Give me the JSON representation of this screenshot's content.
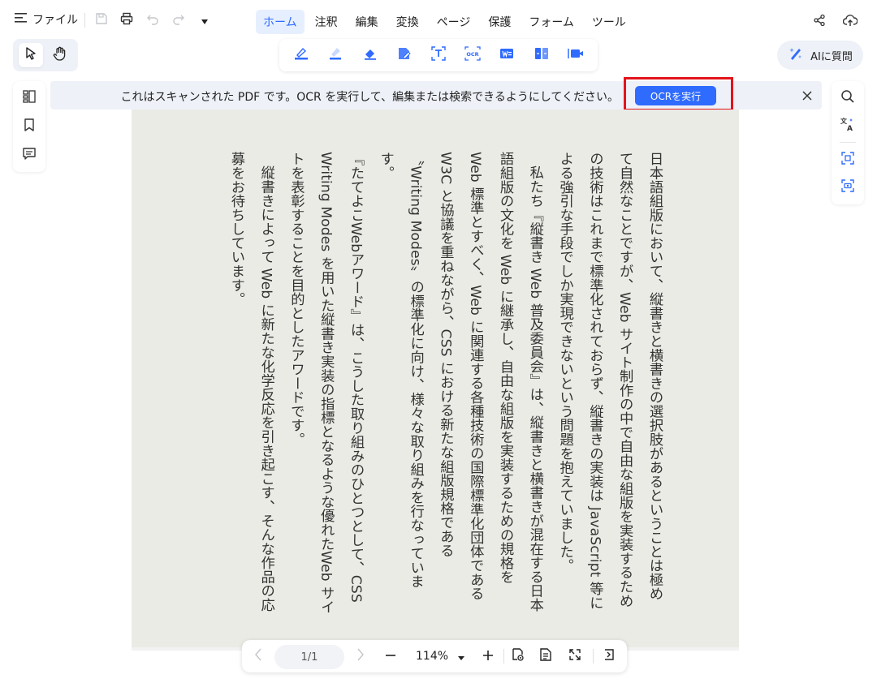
{
  "menu": {
    "file_label": "ファイル",
    "tabs": [
      {
        "label": "ホーム",
        "active": true
      },
      {
        "label": "注釈",
        "active": false
      },
      {
        "label": "編集",
        "active": false
      },
      {
        "label": "変換",
        "active": false
      },
      {
        "label": "ページ",
        "active": false
      },
      {
        "label": "保護",
        "active": false
      },
      {
        "label": "フォーム",
        "active": false
      },
      {
        "label": "ツール",
        "active": false
      }
    ]
  },
  "toolbar": {
    "ai_button_label": "AIに質問"
  },
  "banner": {
    "message": "これはスキャンされた PDF です。OCR を実行して、編集または検索できるようにしてください。",
    "ocr_button_label": "OCRを実行"
  },
  "document": {
    "paragraphs": [
      "日本語組版において、縦書きと横書きの選択肢があるということは極めて自然なことですが、Web サイト制作の中で自由な組版を実装するための技術はこれまで標準化されておらず、縦書きの実装は JavaScript 等による強引な手段でしか実現できないという問題を抱えていました。",
      "私たち『縦書き Web 普及委員会』は、縦書きと横書きが混在する日本語組版の文化を Web に継承し、自由な組版を実装するための規格を Web 標準とすべく、Web に関連する各種技術の国際標準化団体である W3C と協議を重ねながら、CSS における新たな組版規格である〝Writing Modes〟の標準化に向け、様々な取り組みを行なっています。",
      "",
      "『たてよこWebアワード』は、こうした取り組みのひとつとして、CSS Writing Modes を用いた縦書き実装の指標となるような優れたWeb サイトを表彰することを目的としたアワードです。",
      "縦書きによって Web に新たな化学反応を引き起こす、そんな作品の応募をお待ちしています。"
    ]
  },
  "navigation": {
    "page_indicator": "1/1",
    "zoom": "114%"
  },
  "colors": {
    "accent": "#2f6bff",
    "highlight_border": "#e3141b",
    "banner_bg": "#eef1f7",
    "page_bg": "#ebebe6"
  }
}
